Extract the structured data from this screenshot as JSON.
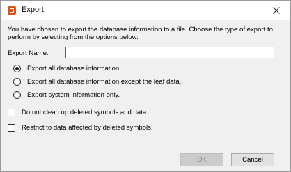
{
  "window": {
    "title": "Export",
    "close_label": "✕"
  },
  "intro_text": "You have chosen to export the database information to a file.  Choose the type of export to perform by selecting from the options below.",
  "export_name": {
    "label": "Export Name:",
    "value": ""
  },
  "options": [
    {
      "label": "Export all database information.",
      "selected": true
    },
    {
      "label": "Export all database information except the leaf data.",
      "selected": false
    },
    {
      "label": "Export system information only.",
      "selected": false
    }
  ],
  "checkboxes": [
    {
      "label": "Do not clean up deleted symbols and data.",
      "checked": false
    },
    {
      "label": "Restrict to data affected by deleted symbols.",
      "checked": false
    }
  ],
  "buttons": {
    "ok_label": "OK",
    "ok_enabled": false,
    "cancel_label": "Cancel"
  },
  "colors": {
    "accent": "#0078d7",
    "app_icon": "#d9531e"
  }
}
